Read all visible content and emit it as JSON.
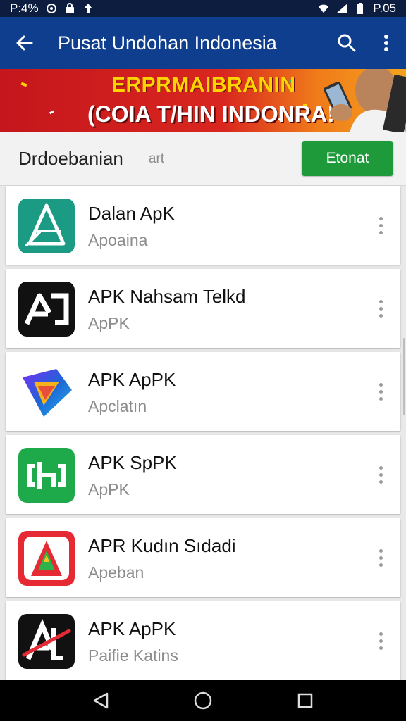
{
  "status_bar": {
    "left_text": "P:4%",
    "time": "P.05",
    "icons": [
      "circle-status-icon",
      "lock-icon",
      "upload-icon",
      "wifi-icon",
      "signal-icon",
      "battery-icon"
    ]
  },
  "app_bar": {
    "title": "Pusat Undohan Indonesia",
    "icons": [
      "back-arrow-icon",
      "search-icon",
      "more-vert-icon"
    ]
  },
  "banner": {
    "line1": "ERPRMAIBRANIN",
    "line2": "(COIA T/HIN INDONRA!"
  },
  "filter": {
    "label": "Drdoebanian",
    "hint": "art",
    "button_label": "Etonat"
  },
  "apps": [
    {
      "name": "Dalan ApK",
      "subtitle": "Apoaina",
      "icon": "teal-a-logo-icon"
    },
    {
      "name": "APK Nahsam Telkd",
      "subtitle": "ApPK",
      "icon": "black-a-logo-icon"
    },
    {
      "name": "APK ApPK",
      "subtitle": "Apclatın",
      "icon": "gradient-play-logo-icon"
    },
    {
      "name": "APK SpPK",
      "subtitle": "ApPK",
      "icon": "green-bracket-logo-icon"
    },
    {
      "name": "APR Kudın Sıdadi",
      "subtitle": "Apeban",
      "icon": "red-a-logo-icon"
    },
    {
      "name": "APK ApPK",
      "subtitle": "Paifie Katins",
      "icon": "black-red-a-logo-icon"
    }
  ],
  "nav_bar": {
    "icons": [
      "back-triangle-icon",
      "home-circle-icon",
      "recents-square-icon"
    ]
  },
  "colors": {
    "status_bar": "#0c1d40",
    "app_bar": "#0f3e8f",
    "accent_green": "#1f9a3a",
    "banner_red": "#c4161c"
  }
}
